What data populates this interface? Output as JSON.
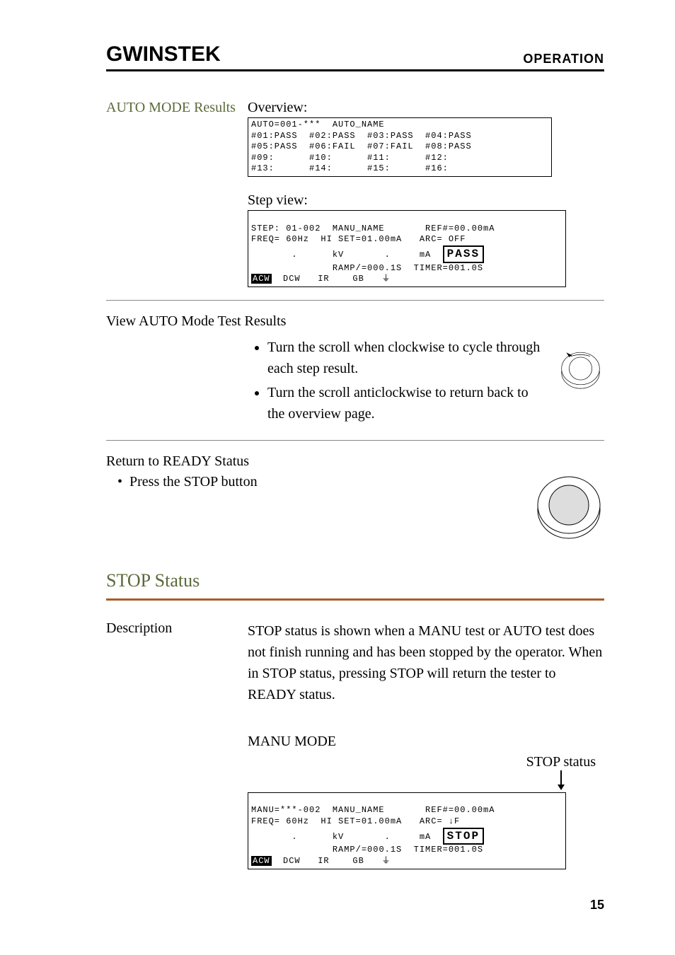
{
  "header": {
    "logo": "GWINSTEK",
    "section": "OPERATION"
  },
  "auto_mode": {
    "title": "AUTO MODE Results",
    "overview_label": "Overview:",
    "overview_lcd": "AUTO=001-***  AUTO_NAME\n#01:PASS  #02:PASS  #03:PASS  #04:PASS\n#05:PASS  #06:FAIL  #07:FAIL  #08:PASS\n#09:      #10:      #11:      #12:\n#13:      #14:      #15:      #16:\n",
    "stepview_label": "Step view:",
    "step_line1": "STEP: 01-002  MANU_NAME       REF#=00.00mA",
    "step_line2": "FREQ= 60Hz  HI SET=01.00mA   ARC= OFF",
    "step_kv": "kV",
    "step_ma": "mA",
    "step_pass": "PASS",
    "step_ramp": "RAMP/=000.1S  TIMER=001.0S",
    "step_modes_acw": "ACW",
    "step_modes_rest": "  DCW   IR    GB"
  },
  "view_results": {
    "heading": "View AUTO Mode Test Results",
    "bullets": [
      "Turn the scroll when clockwise to cycle through each step result.",
      "Turn the scroll anticlockwise to return back to the overview page."
    ]
  },
  "return_ready": {
    "heading": "Return to READY Status",
    "bullet": "Press the STOP button"
  },
  "stop_status": {
    "heading": "STOP Status",
    "desc_label": "Description",
    "desc_text": "STOP status is shown when a MANU test or AUTO test does not finish running and has been stopped by the operator. When in STOP status, pressing STOP will return the tester to READY status.",
    "mode_label": "MANU MODE",
    "status_label": "STOP status",
    "lcd_line1": "MANU=***-002  MANU_NAME       REF#=00.00mA",
    "lcd_line2": "FREQ= 60Hz  HI SET=01.00mA   ARC= ",
    "lcd_arc_arrow": "↓F",
    "lcd_kv": "kV",
    "lcd_ma": "mA",
    "lcd_stop": "STOP",
    "lcd_ramp": "RAMP/=000.1S  TIMER=001.0S",
    "lcd_modes_acw": "ACW",
    "lcd_modes_rest": "  DCW   IR    GB"
  },
  "footer": {
    "page_number": "15"
  }
}
